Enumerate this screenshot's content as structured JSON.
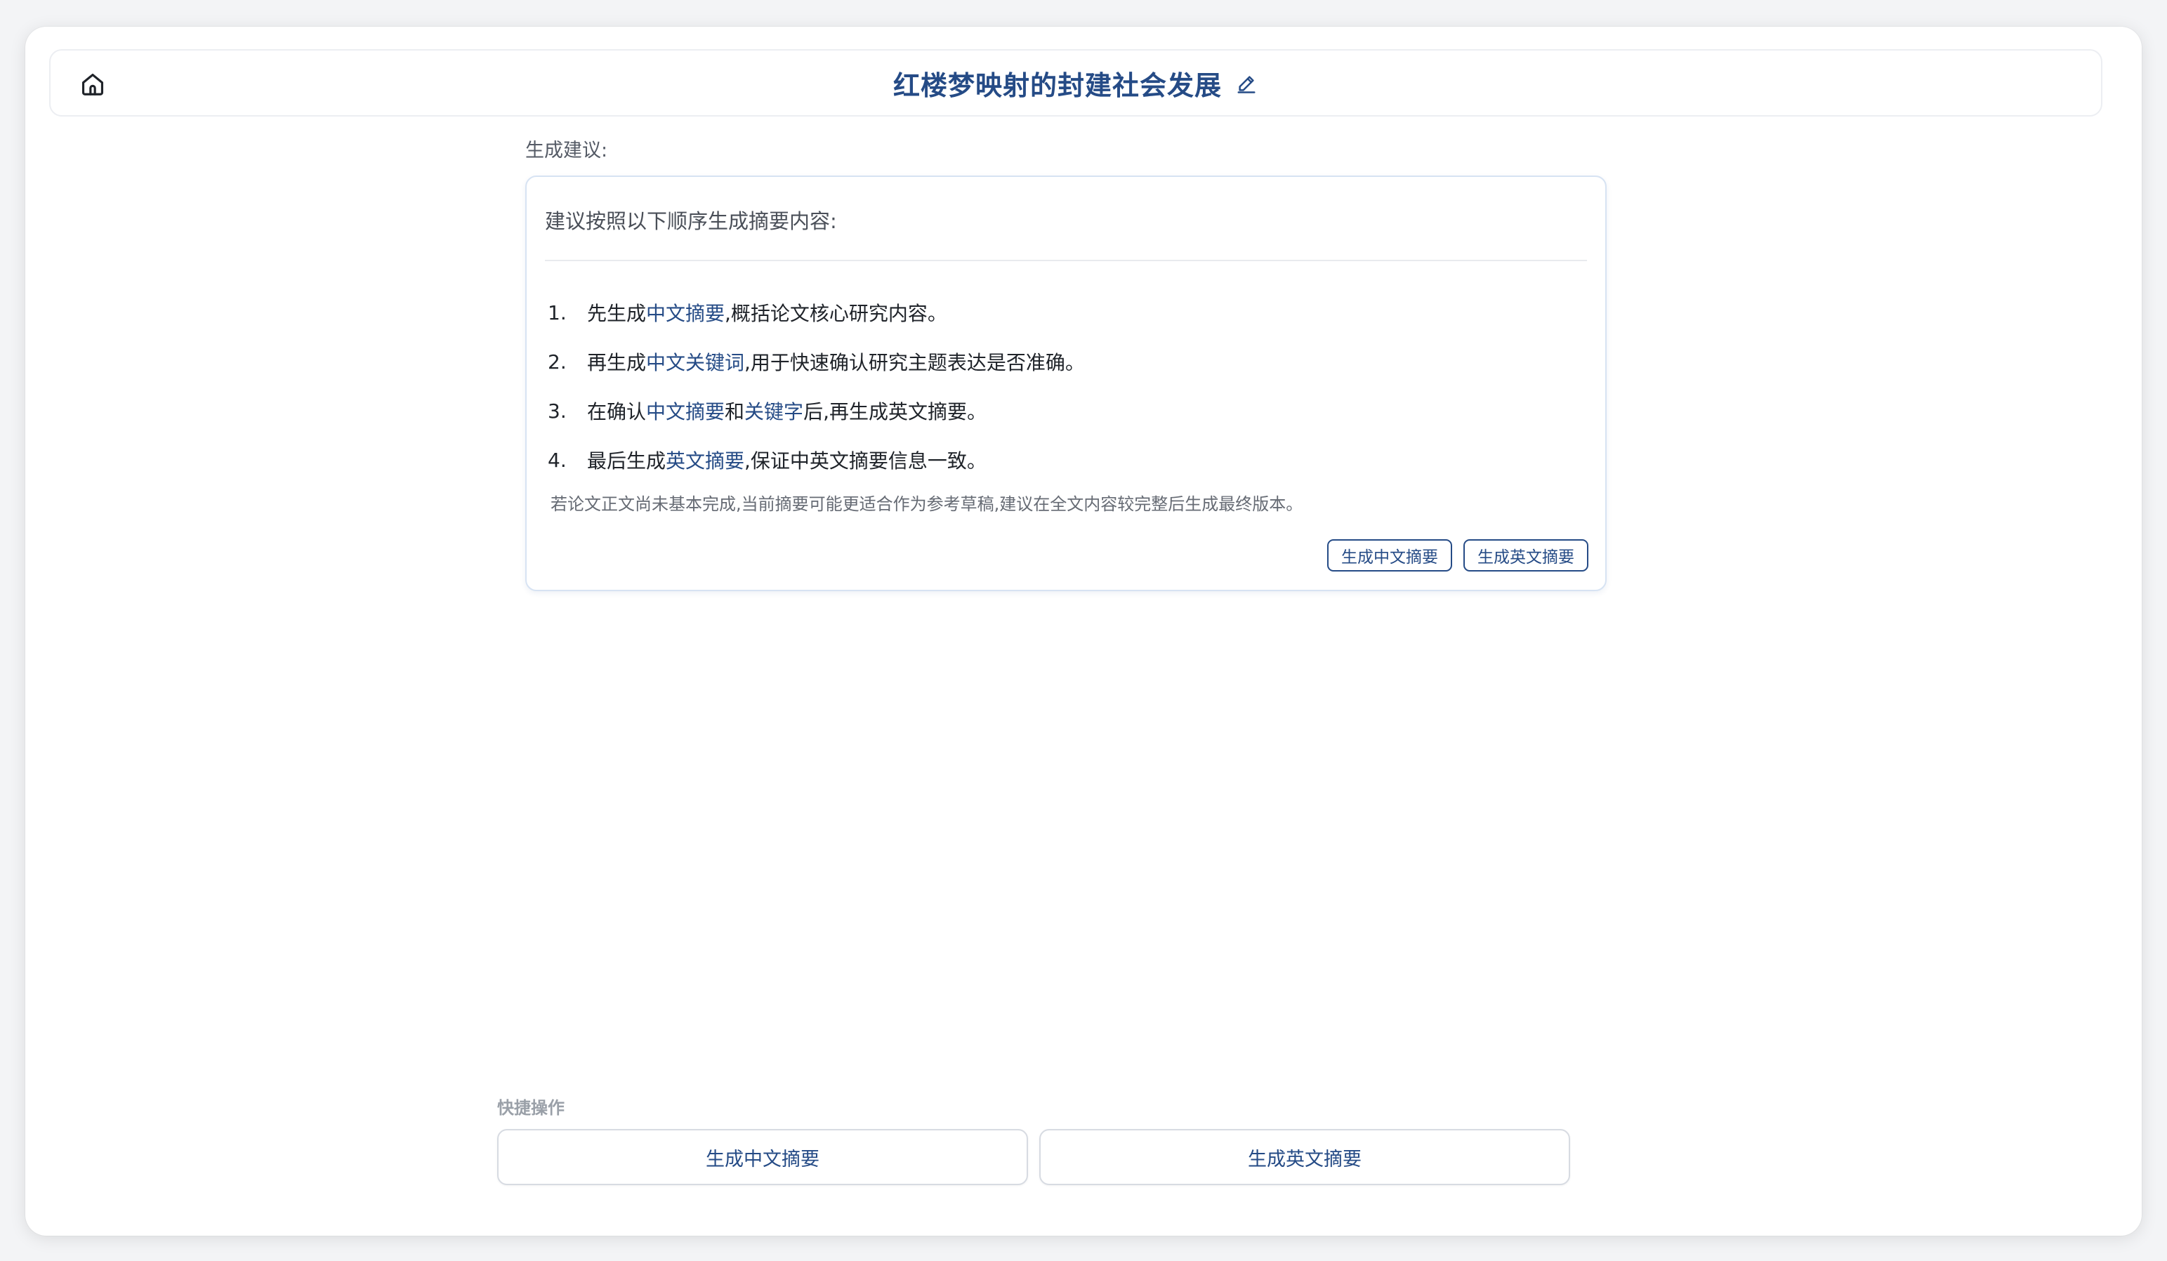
{
  "header": {
    "title": "红楼梦映射的封建社会发展",
    "home_icon": "home-icon",
    "edit_icon": "pencil-icon"
  },
  "suggestion": {
    "label": "生成建议:",
    "intro": "建议按照以下顺序生成摘要内容:",
    "steps": [
      {
        "num": "1.",
        "parts": [
          "先生成",
          "中文摘要",
          ",概括论文核心研究内容。"
        ]
      },
      {
        "num": "2.",
        "parts": [
          "再生成",
          "中文关键词",
          ",用于快速确认研究主题表达是否准确。"
        ]
      },
      {
        "num": "3.",
        "parts": [
          "在确认",
          "中文摘要",
          "和",
          "关键字",
          "后,再生成英文摘要。"
        ]
      },
      {
        "num": "4.",
        "parts": [
          "最后生成",
          "英文摘要",
          ",保证中英文摘要信息一致。"
        ]
      }
    ],
    "note": "若论文正文尚未基本完成,当前摘要可能更适合作为参考草稿,建议在全文内容较完整后生成最终版本。",
    "actions": {
      "gen_cn": "生成中文摘要",
      "gen_en": "生成英文摘要"
    }
  },
  "quick": {
    "label": "快捷操作",
    "gen_cn": "生成中文摘要",
    "gen_en": "生成英文摘要"
  },
  "colors": {
    "accent": "#254b86",
    "card_border": "#d7e3f3"
  }
}
